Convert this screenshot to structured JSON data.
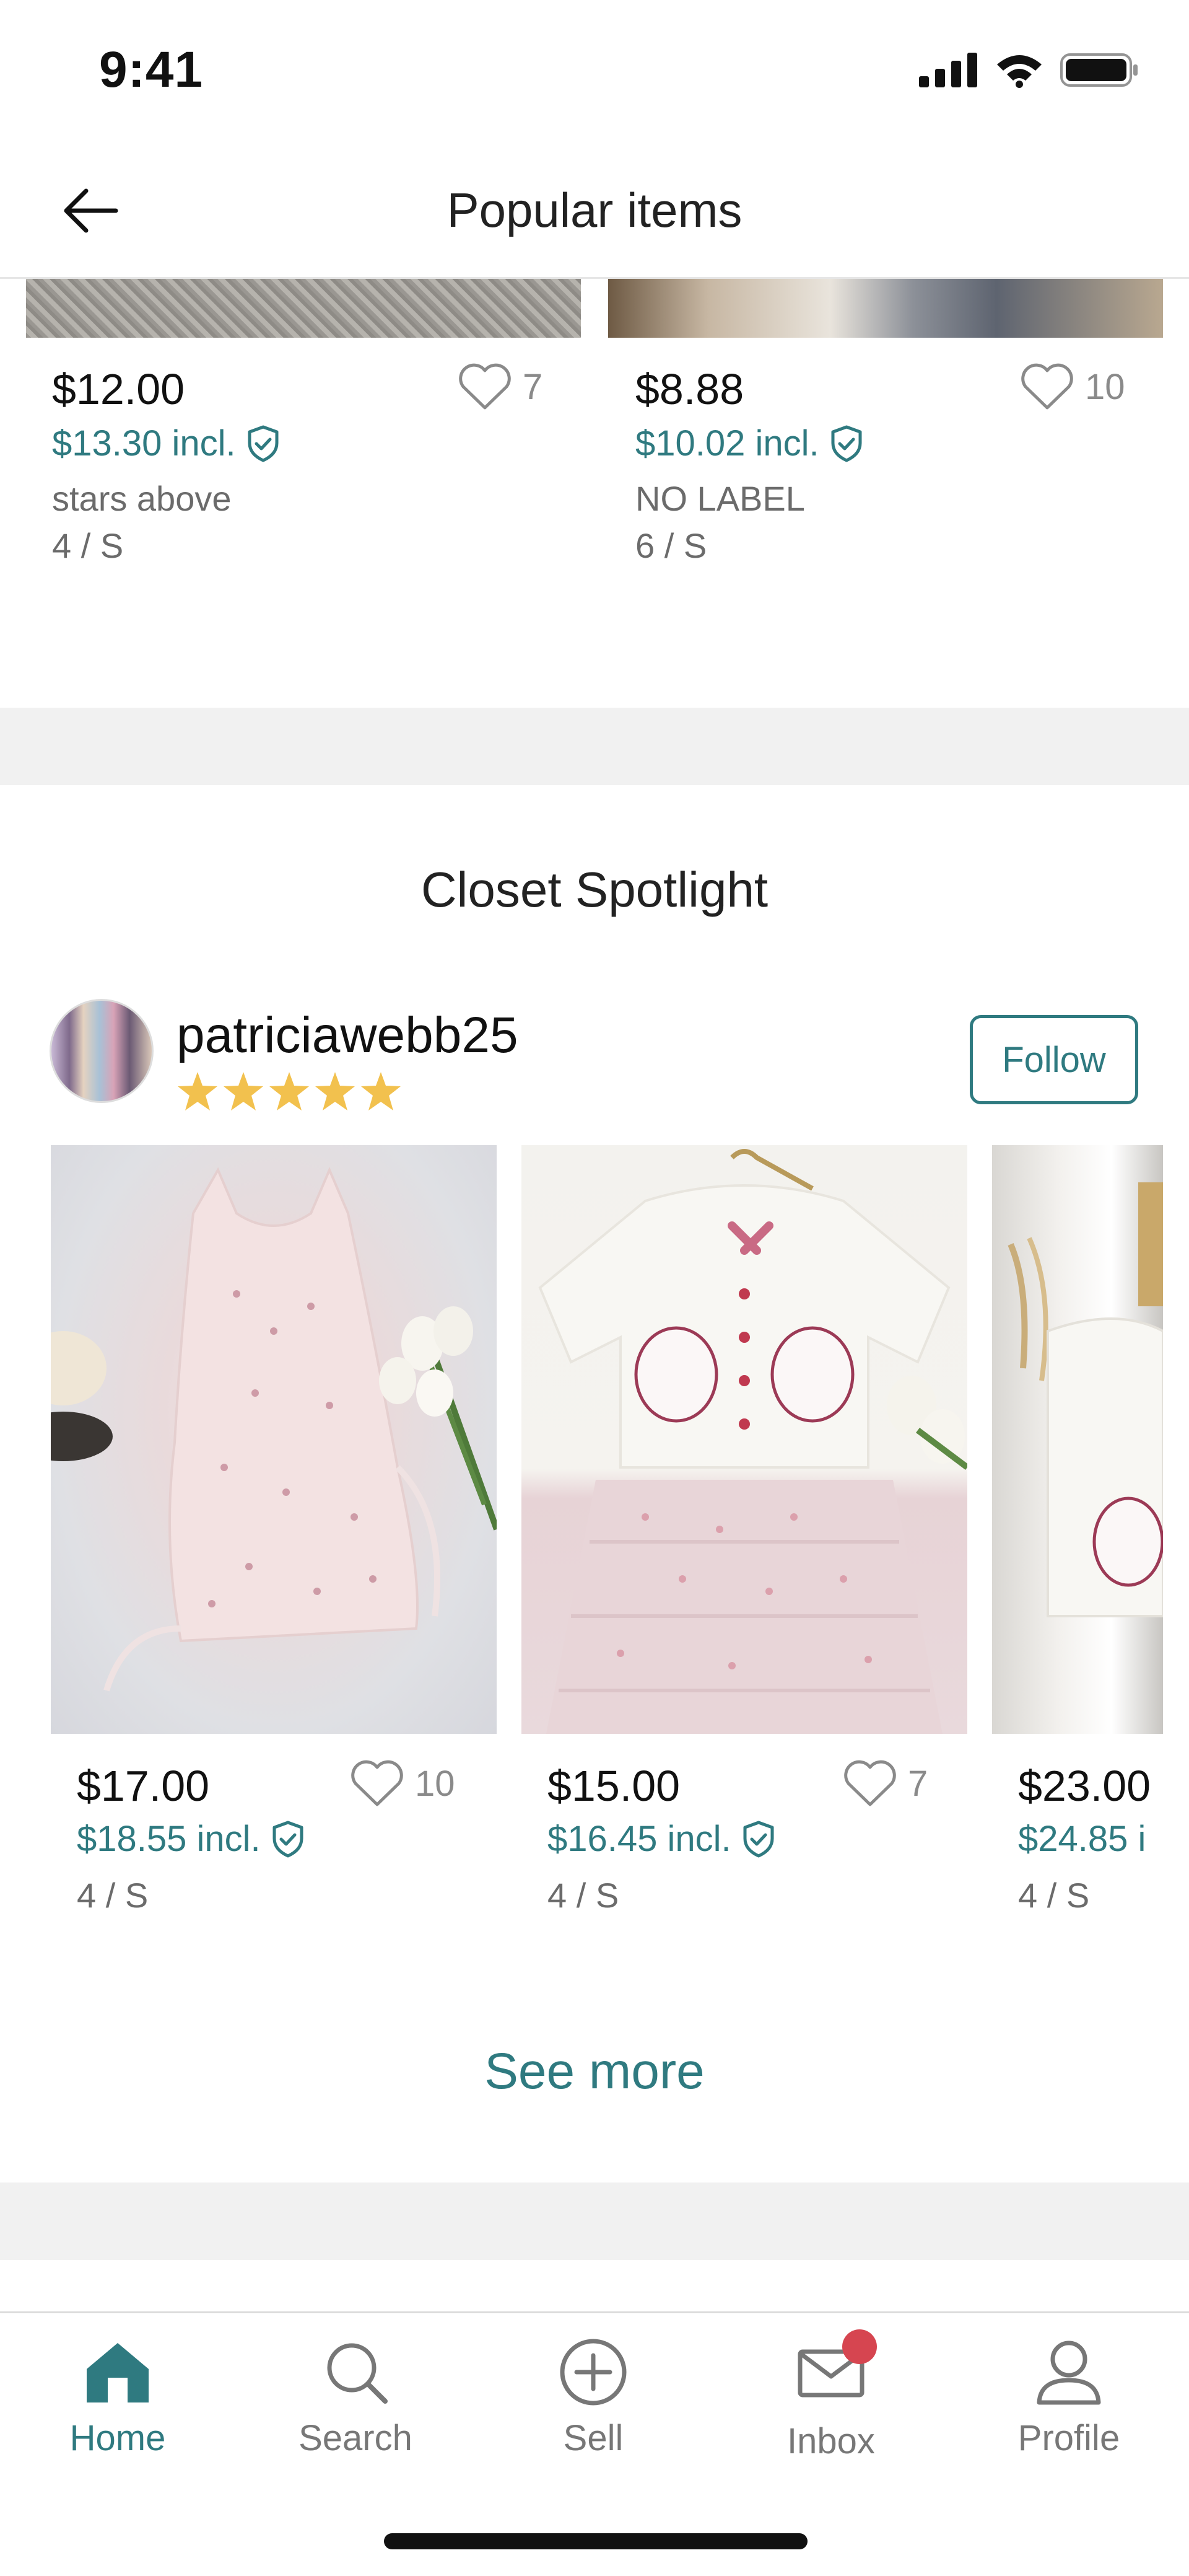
{
  "status_bar": {
    "time": "9:41"
  },
  "nav": {
    "title": "Popular items"
  },
  "popular_items": [
    {
      "price": "$12.00",
      "price_incl": "$13.30 incl.",
      "likes": "7",
      "brand": "stars above",
      "size": "4 / S"
    },
    {
      "price": "$8.88",
      "price_incl": "$10.02 incl.",
      "likes": "10",
      "brand": "NO LABEL",
      "size": "6 / S"
    }
  ],
  "spotlight": {
    "title": "Closet Spotlight",
    "username": "patriciawebb25",
    "rating_stars": 5,
    "follow_label": "Follow",
    "items": [
      {
        "price": "$17.00",
        "price_incl": "$18.55 incl.",
        "likes": "10",
        "size": "4 / S"
      },
      {
        "price": "$15.00",
        "price_incl": "$16.45 incl.",
        "likes": "7",
        "size": "4 / S"
      },
      {
        "price": "$23.00",
        "price_incl": "$24.85 i",
        "size": "4 / S"
      }
    ],
    "see_more_label": "See more"
  },
  "tabs": [
    {
      "label": "Home",
      "icon": "home-icon",
      "active": true
    },
    {
      "label": "Search",
      "icon": "search-icon",
      "active": false
    },
    {
      "label": "Sell",
      "icon": "plus-circle-icon",
      "active": false
    },
    {
      "label": "Inbox",
      "icon": "envelope-icon",
      "active": false,
      "badge": true
    },
    {
      "label": "Profile",
      "icon": "person-icon",
      "active": false
    }
  ],
  "colors": {
    "accent": "#2f7a80",
    "star": "#f2c14e",
    "badge": "#d64550",
    "band": "#f1f1f1"
  }
}
